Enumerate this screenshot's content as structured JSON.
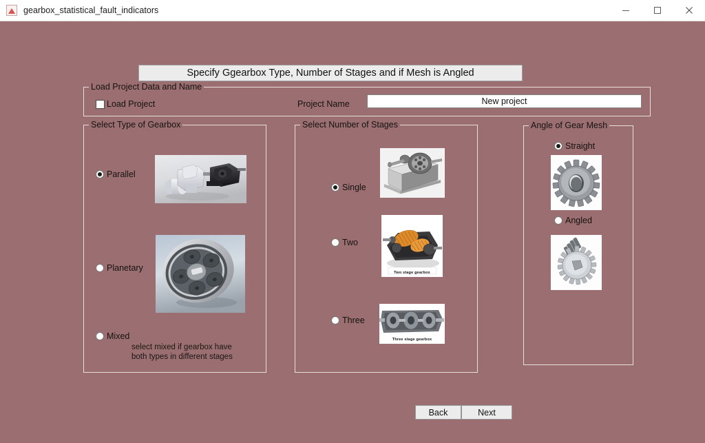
{
  "window": {
    "title": "gearbox_statistical_fault_indicators",
    "app_icon": "matlab-icon",
    "minimize": "minimize-icon",
    "maximize": "maximize-icon",
    "close": "close-icon",
    "background_color": "#9b6f72",
    "titlebar_color": "#ffffff"
  },
  "banner": {
    "text": "Specify Ggearbox Type, Number of Stages and if Mesh is Angled"
  },
  "load_panel": {
    "title": "Load Project Data and Name",
    "checkbox_label": "Load Project",
    "checkbox_checked": false,
    "project_name_label": "Project Name",
    "project_name_value": "New project",
    "project_name_placeholder": "New project"
  },
  "type_panel": {
    "title": "Select Type of Gearbox",
    "options": [
      {
        "label": "Parallel",
        "selected": true,
        "image": "parallel-gearbox-image"
      },
      {
        "label": "Planetary",
        "selected": false,
        "image": "planetary-gearbox-image"
      },
      {
        "label": "Mixed",
        "selected": false,
        "image": ""
      }
    ],
    "hint": "select mixed if gearbox have\nboth types in different stages"
  },
  "stages_panel": {
    "title": "Select Number of Stages",
    "options": [
      {
        "label": "Single",
        "selected": true,
        "image": "single-stage-gearbox-image",
        "caption": ""
      },
      {
        "label": "Two",
        "selected": false,
        "image": "two-stage-gearbox-image",
        "caption": "Two stage gearbox"
      },
      {
        "label": "Three",
        "selected": false,
        "image": "three-stage-gearbox-image",
        "caption": "Three stage gearbox"
      }
    ]
  },
  "angle_panel": {
    "title": "Angle of Gear Mesh",
    "options": [
      {
        "label": "Straight",
        "selected": true,
        "image": "spur-gear-image"
      },
      {
        "label": "Angled",
        "selected": false,
        "image": "helical-gear-image"
      }
    ]
  },
  "footer": {
    "back_label": "Back",
    "next_label": "Next"
  }
}
